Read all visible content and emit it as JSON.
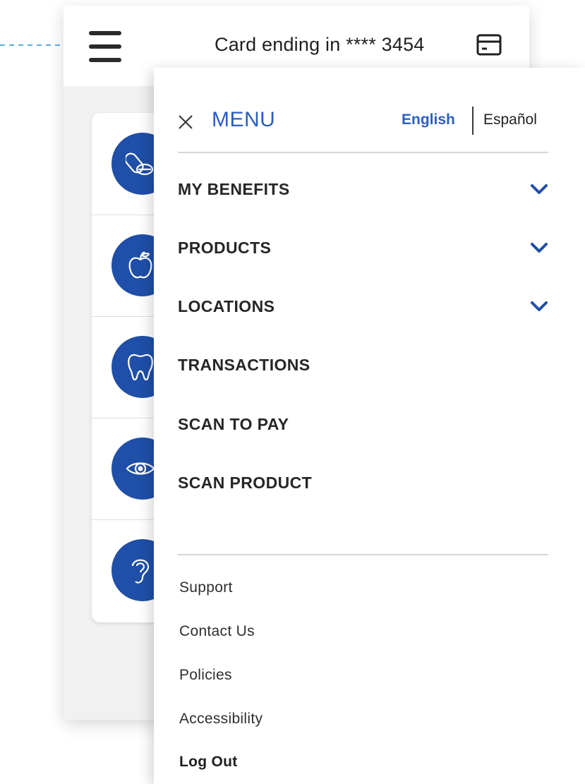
{
  "header": {
    "card_text": "Card ending in **** 3454"
  },
  "benefit_categories": [
    {
      "icon": "pill-icon"
    },
    {
      "icon": "apple-icon"
    },
    {
      "icon": "tooth-icon"
    },
    {
      "icon": "eye-icon"
    },
    {
      "icon": "ear-icon"
    }
  ],
  "menu": {
    "title": "MENU",
    "languages": {
      "selected": "English",
      "other": "Español"
    },
    "items": [
      {
        "label": "MY BENEFITS",
        "expandable": true
      },
      {
        "label": "PRODUCTS",
        "expandable": true
      },
      {
        "label": "LOCATIONS",
        "expandable": true
      },
      {
        "label": "TRANSACTIONS",
        "expandable": false
      },
      {
        "label": "SCAN TO PAY",
        "expandable": false
      },
      {
        "label": "SCAN PRODUCT",
        "expandable": false
      }
    ],
    "footer_links": [
      {
        "label": "Support"
      },
      {
        "label": "Contact Us"
      },
      {
        "label": "Policies"
      },
      {
        "label": "Accessibility"
      },
      {
        "label": "Log Out"
      }
    ]
  },
  "colors": {
    "accent_blue": "#2a5fc0",
    "icon_circle_blue": "#1f4fa8",
    "annotation_arrow": "#5aaee0",
    "text_dark": "#262626",
    "background_grey": "#f1f1f2"
  }
}
